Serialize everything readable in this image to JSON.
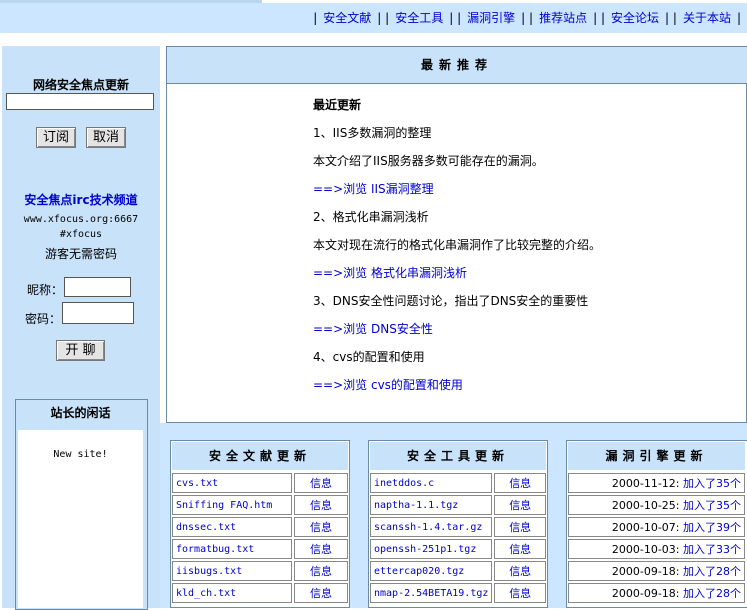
{
  "nav": {
    "items": [
      "安全文献",
      "安全工具",
      "漏洞引擎",
      "推荐站点",
      "安全论坛",
      "关于本站"
    ]
  },
  "left": {
    "subscribe_title": "网络安全焦点更新",
    "subscribe_btn": "订阅",
    "cancel_btn": "取消",
    "irc_title": "安全焦点irc技术频道",
    "irc_server": "www.xfocus.org:6667",
    "irc_channel": "#xfocus",
    "guest_note": "游客无需密码",
    "nick_label": "昵称：",
    "pass_label": "密码：",
    "chat_btn": "开 聊",
    "notes_title": "站长的闲话",
    "notes_text": "New site!"
  },
  "recommend": {
    "title": "最新推荐",
    "recent": "最近更新",
    "items": [
      {
        "title": "1、IIS多数漏洞的整理",
        "desc": "本文介绍了IIS服务器多数可能存在的漏洞。",
        "link": "==>浏览 IIS漏洞整理"
      },
      {
        "title": "2、格式化串漏洞浅析",
        "desc": "本文对现在流行的格式化串漏洞作了比较完整的介绍。",
        "link": "==>浏览 格式化串漏洞浅析"
      },
      {
        "title": "3、DNS安全性问题讨论，指出了DNS安全的重要性",
        "desc": "",
        "link": "==>浏览 DNS安全性"
      },
      {
        "title": "4、cvs的配置和使用",
        "desc": "",
        "link": "==>浏览 cvs的配置和使用"
      }
    ]
  },
  "docs": {
    "title": "安全文献更新",
    "info_label": "信息",
    "rows": [
      "cvs.txt",
      "Sniffing FAQ.htm",
      "dnssec.txt",
      "formatbug.txt",
      "iisbugs.txt",
      "kld_ch.txt"
    ]
  },
  "tools": {
    "title": "安全工具更新",
    "info_label": "信息",
    "rows": [
      "inetddos.c",
      "naptha-1.1.tgz",
      "scanssh-1.4.tar.gz",
      "openssh-251p1.tgz",
      "ettercap020.tgz",
      "nmap-2.54BETA19.tgz"
    ]
  },
  "vulns": {
    "title": "漏洞引擎更新",
    "rows": [
      {
        "date": "2000-11-12:",
        "added": "加入了35个"
      },
      {
        "date": "2000-10-25:",
        "added": "加入了35个"
      },
      {
        "date": "2000-10-07:",
        "added": "加入了39个"
      },
      {
        "date": "2000-10-03:",
        "added": "加入了33个"
      },
      {
        "date": "2000-09-18:",
        "added": "加入了28个"
      },
      {
        "date": "2000-09-18:",
        "added": "加入了28个"
      }
    ]
  }
}
